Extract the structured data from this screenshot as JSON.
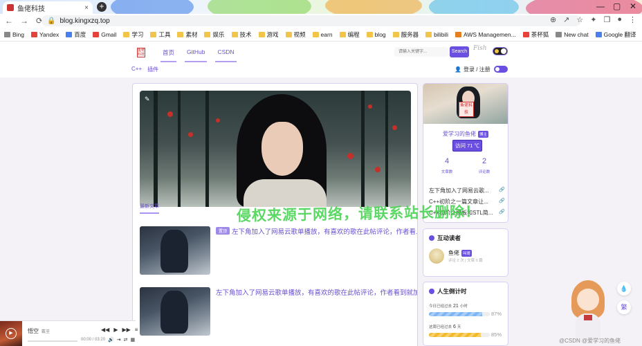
{
  "browser": {
    "tab_title": "鱼佬科技",
    "tab_close": "×",
    "new_tab": "+",
    "window_controls": {
      "minimize": "—",
      "maximize": "▢",
      "close": "✕"
    },
    "url": "blog.kingxzq.top",
    "nav_back": "←",
    "nav_forward": "→",
    "nav_reload": "⟳",
    "nav_right_icons": [
      "⊕",
      "↗",
      "☆",
      "✦",
      "❒",
      "●",
      "⋮"
    ]
  },
  "bookmarks": [
    {
      "label": "Bing",
      "icon": "search-icon",
      "color": "#888"
    },
    {
      "label": "Yandex",
      "icon": "yandex-icon",
      "color": "#e4423a"
    },
    {
      "label": "百度",
      "icon": "baidu-icon",
      "color": "#4a7ff0"
    },
    {
      "label": "Gmail",
      "icon": "gmail-icon",
      "color": "#e4423a"
    },
    {
      "label": "学习",
      "icon": "folder-icon",
      "color": "#f2c54a"
    },
    {
      "label": "工具",
      "icon": "folder-icon",
      "color": "#f2c54a"
    },
    {
      "label": "素材",
      "icon": "folder-icon",
      "color": "#f2c54a"
    },
    {
      "label": "娱乐",
      "icon": "folder-icon",
      "color": "#f2c54a"
    },
    {
      "label": "技术",
      "icon": "folder-icon",
      "color": "#f2c54a"
    },
    {
      "label": "游戏",
      "icon": "folder-icon",
      "color": "#f2c54a"
    },
    {
      "label": "视频",
      "icon": "folder-icon",
      "color": "#f2c54a"
    },
    {
      "label": "earn",
      "icon": "folder-icon",
      "color": "#f2c54a"
    },
    {
      "label": "编程",
      "icon": "folder-icon",
      "color": "#f2c54a"
    },
    {
      "label": "blog",
      "icon": "folder-icon",
      "color": "#f2c54a"
    },
    {
      "label": "服务器",
      "icon": "folder-icon",
      "color": "#f2c54a"
    },
    {
      "label": "bilibili",
      "icon": "folder-icon",
      "color": "#f2c54a"
    },
    {
      "label": "AWS Managemen...",
      "icon": "aws-icon",
      "color": "#e67e22"
    },
    {
      "label": "茶杯狐",
      "icon": "cup-icon",
      "color": "#e4423a"
    },
    {
      "label": "New chat",
      "icon": "chat-icon",
      "color": "#888"
    },
    {
      "label": "Google 翻译",
      "icon": "translate-icon",
      "color": "#4a7ff0"
    }
  ],
  "site": {
    "logo_text": "鱼佬科技",
    "nav": [
      "首页",
      "GitHub",
      "CSDN"
    ],
    "search_placeholder": "请输入关键字...",
    "search_button": "Search",
    "signature": "Fish",
    "subnav": [
      "C++",
      "插件"
    ],
    "login_label": "登录 / 注册",
    "accent_color": "#6b4fe0"
  },
  "main": {
    "hero_icon": "pen-icon",
    "latest_label": "最新文章",
    "posts": [
      {
        "tag": "置顶",
        "title": "左下角加入了网易云歌单播放，有喜欢的歌在此帖评论，作者看..."
      },
      {
        "tag": "",
        "title": "左下角加入了网易云歌单播放，有喜欢的歌在此帖评论，作者看到就加"
      }
    ]
  },
  "watermark": "侵权来源于网络，请联系站长删除！",
  "profile": {
    "seal": "鱼佬科技",
    "name": "爱学习的鱼佬",
    "badge": "博主",
    "visits": "访问 71 ℃",
    "stats": [
      {
        "value": "4",
        "label": "文章数"
      },
      {
        "value": "2",
        "label": "评论数"
      }
    ],
    "recent_posts": [
      "左下角加入了网易云歌...",
      "C++初阶之一篇文章让...",
      "C++初阶之模板和STL简..."
    ],
    "link_icon": "🔗"
  },
  "readers": {
    "title": "互动读者",
    "name": "鱼佬",
    "badge": "叫哥",
    "meta": "评论 2 次 | 文章 0 篇"
  },
  "countdown": {
    "title": "人生倒计时",
    "items": [
      {
        "label_pre": "今日已经过去",
        "value": "21",
        "unit": "小时",
        "percent": 87,
        "percent_text": "87%"
      },
      {
        "label_pre": "这周已经过去",
        "value": "6",
        "unit": "天",
        "percent": 85,
        "percent_text": "85%"
      }
    ]
  },
  "floating": {
    "top_icon": "💧",
    "bottom_label": "繁"
  },
  "copyright": "@CSDN @爱学习的鱼佬",
  "player": {
    "song": "悟空",
    "artist": "戴荃",
    "time": "00:00 / 03:20",
    "controls": [
      "◀◀",
      "▶",
      "▶▶",
      "≡"
    ],
    "icons": [
      "🔊",
      "⇥",
      "⇄",
      "▦"
    ],
    "toggle": "‹"
  }
}
